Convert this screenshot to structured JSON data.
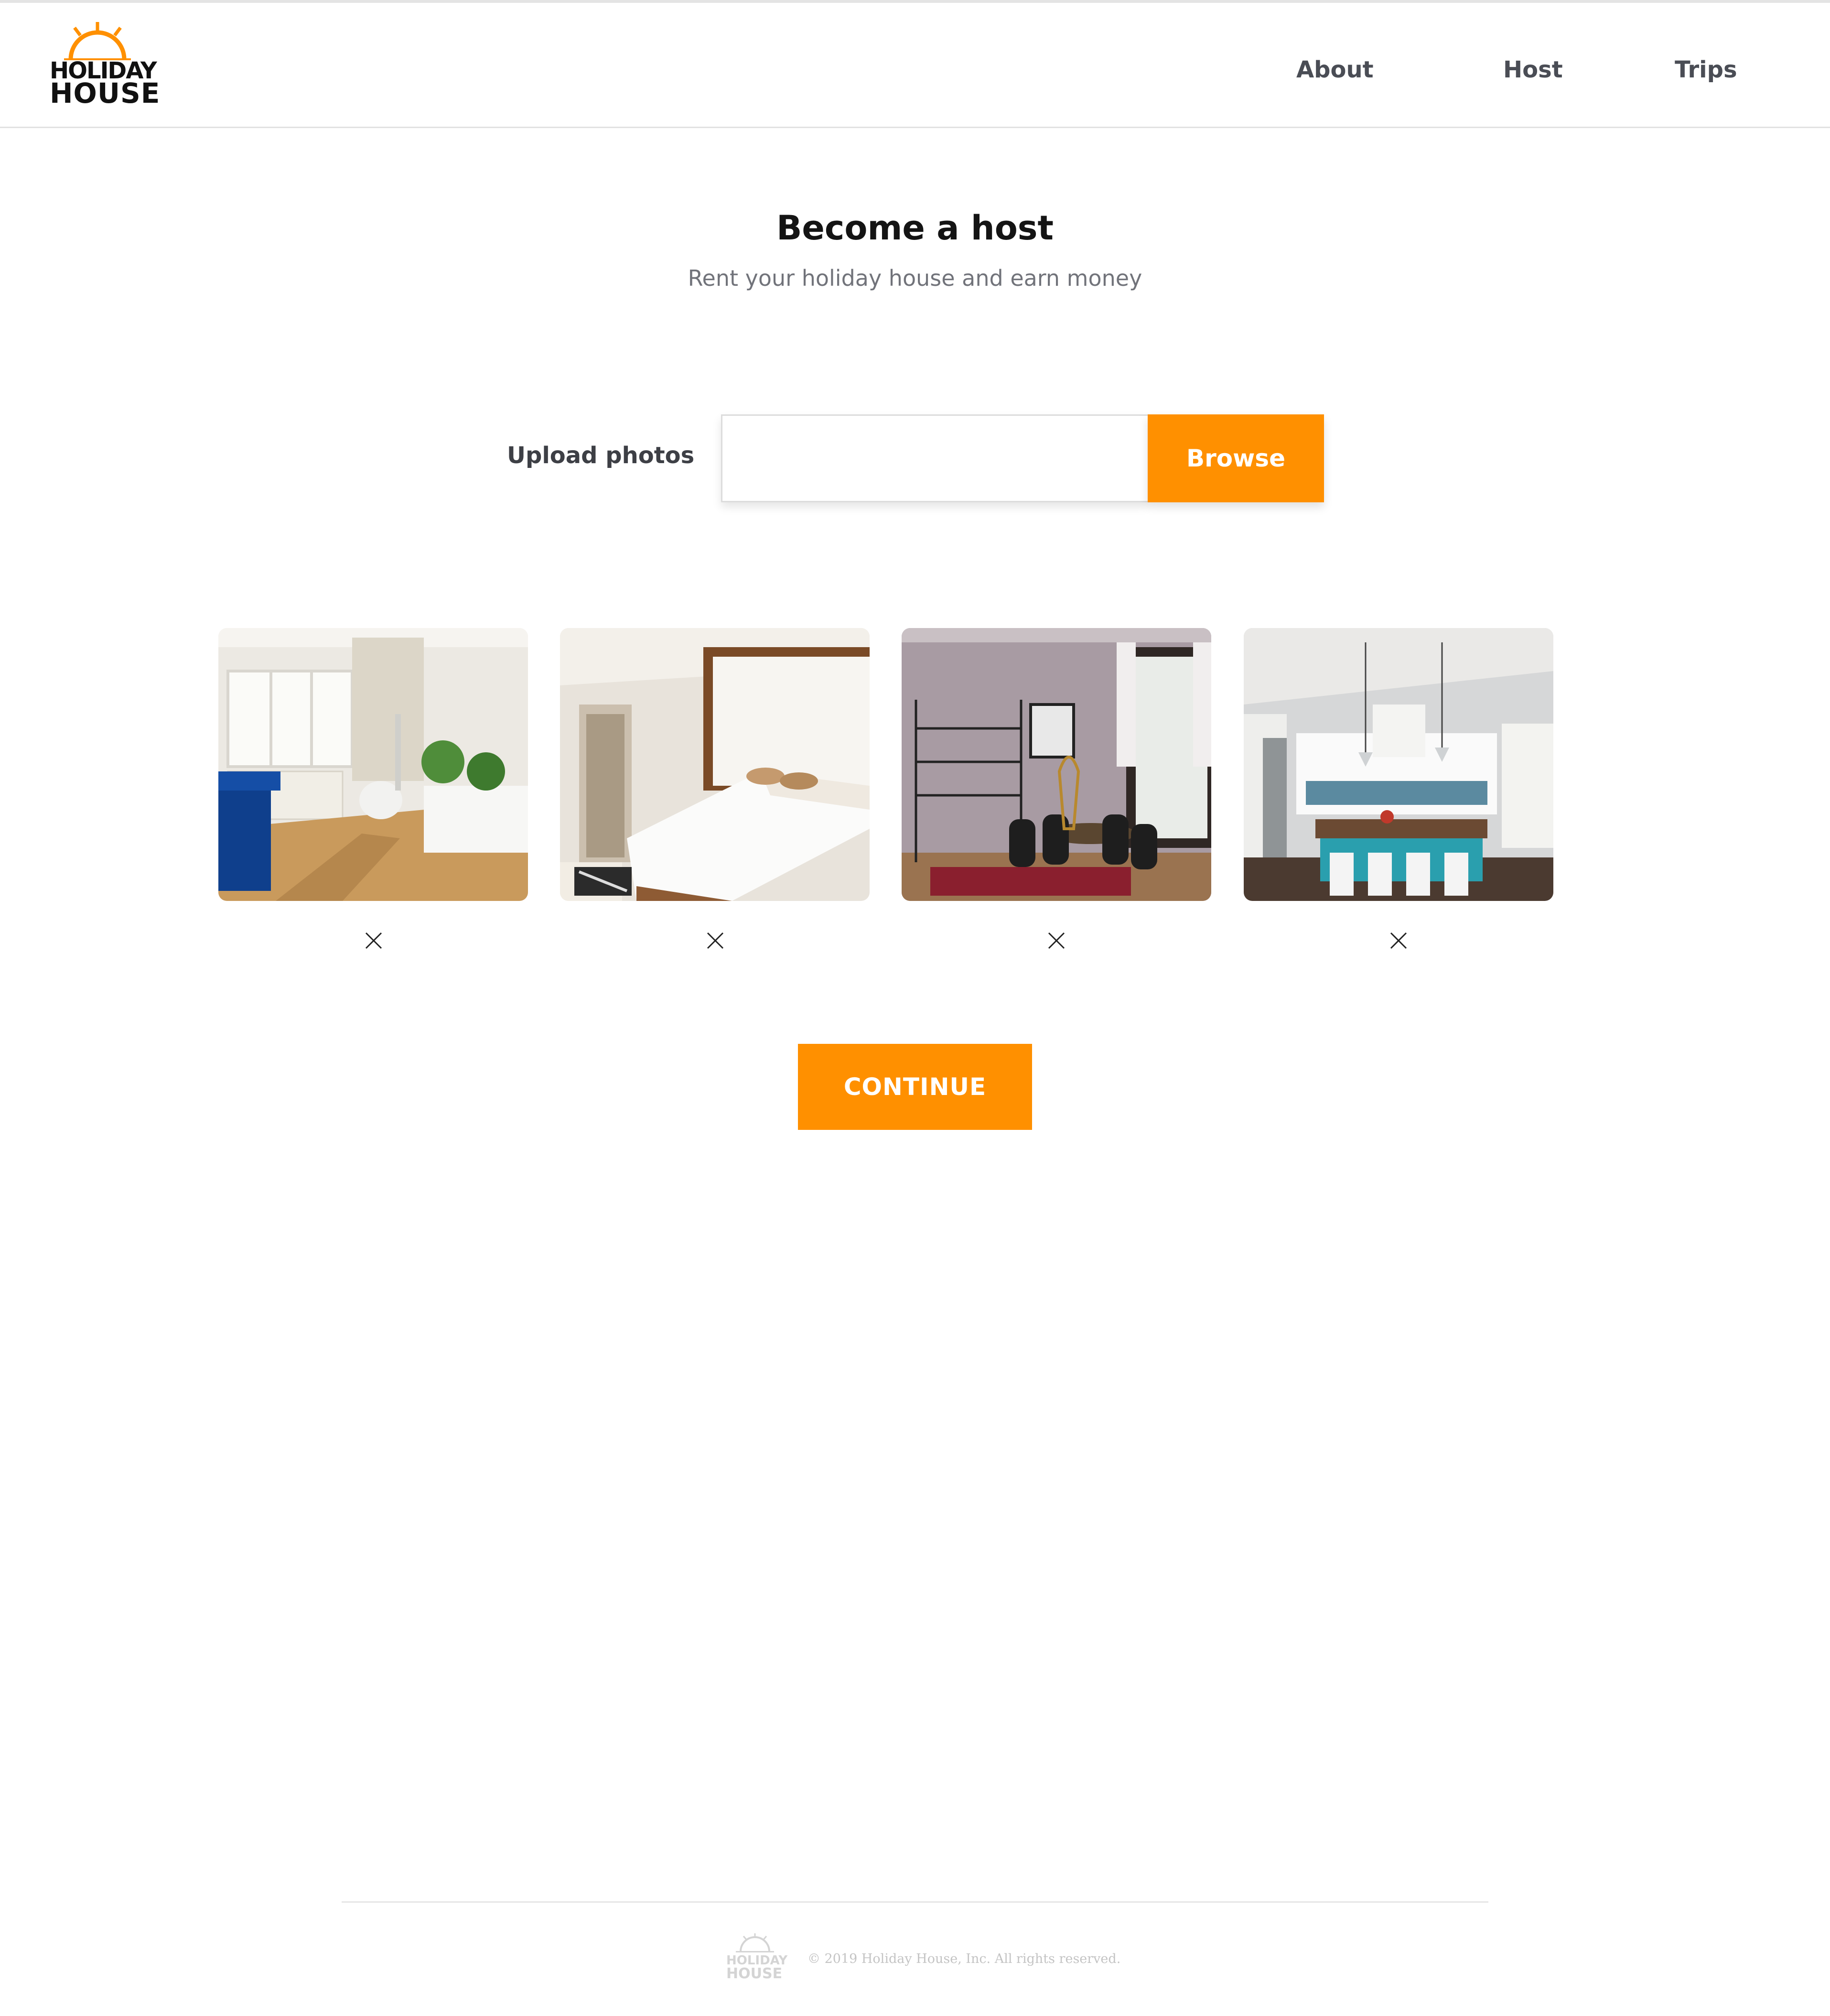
{
  "brand": {
    "logo_line1": "HOLIDAY",
    "logo_line2": "HOUSE",
    "accent_color": "#ff9000"
  },
  "nav": {
    "items": [
      {
        "label": "About"
      },
      {
        "label": "Host"
      },
      {
        "label": "Trips"
      }
    ]
  },
  "main": {
    "title": "Become a host",
    "subtitle": "Rent your holiday house and earn money",
    "upload": {
      "label": "Upload photos",
      "value": "",
      "browse_label": "Browse"
    },
    "photos": [
      {
        "subject": "living-room",
        "remove_icon": "close-icon"
      },
      {
        "subject": "bedroom",
        "remove_icon": "close-icon"
      },
      {
        "subject": "dining-room",
        "remove_icon": "close-icon"
      },
      {
        "subject": "kitchen",
        "remove_icon": "close-icon"
      }
    ],
    "continue_label": "CONTINUE"
  },
  "footer": {
    "logo_line1": "HOLIDAY",
    "logo_line2": "HOUSE",
    "copyright": "© 2019 Holiday House, Inc. All rights reserved."
  }
}
